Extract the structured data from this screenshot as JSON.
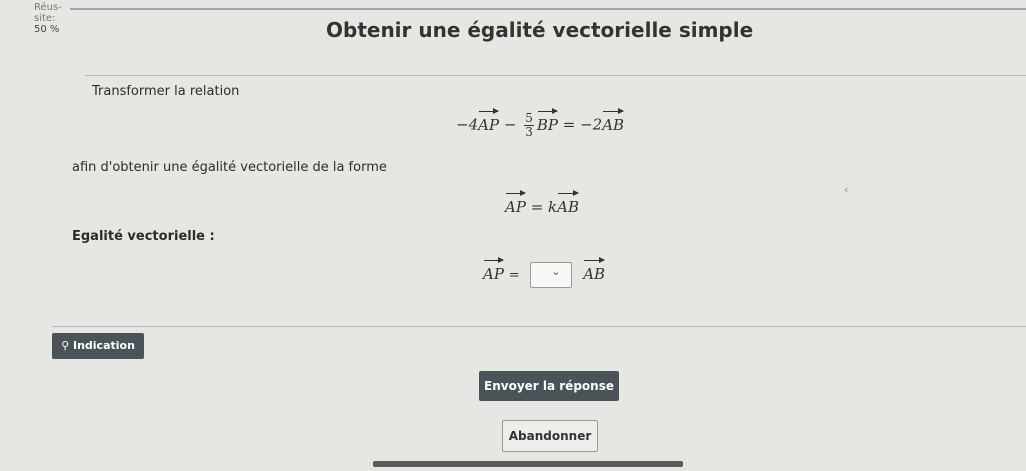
{
  "progress": {
    "line1": "Réus-",
    "line2": "site:",
    "line3": "50 %"
  },
  "title": "Obtenir une égalité vectorielle simple",
  "prompt": "Transformer la relation",
  "equation1": {
    "c1": "−4",
    "v1": "AP",
    "minus": "−",
    "frac_num": "5",
    "frac_den": "3",
    "v2": "BP",
    "eq": "= −2",
    "v3": "AB"
  },
  "instruction": "afin d'obtenir une égalité vectorielle de la forme",
  "equation2": {
    "v1": "AP",
    "eq": "= k",
    "v2": "AB"
  },
  "answer_label": "Egalité vectorielle :",
  "answer": {
    "v1": "AP",
    "eq": "=",
    "select_value": "",
    "v2": "AB"
  },
  "buttons": {
    "hint": "Indication",
    "send": "Envoyer la réponse",
    "abandon": "Abandonner"
  },
  "colors": {
    "button_dark": "#4a5358",
    "background": "#e6e6e3"
  }
}
